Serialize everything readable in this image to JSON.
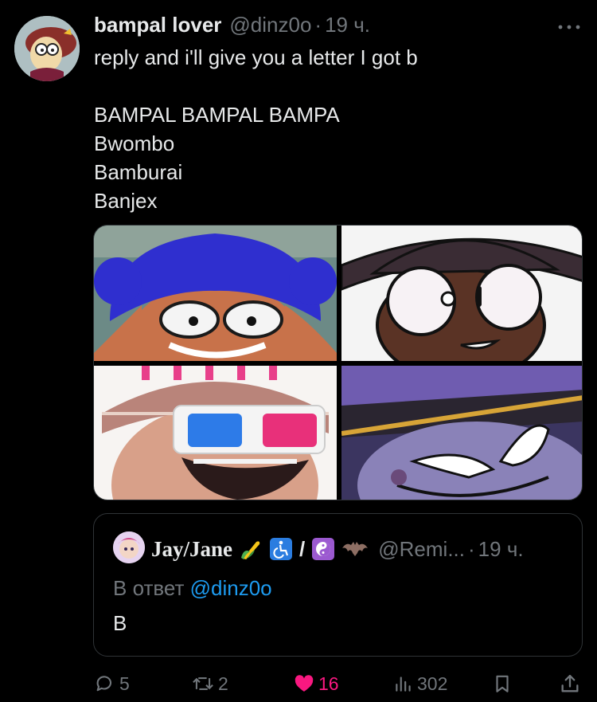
{
  "post": {
    "author_name": "bampal lover",
    "author_handle": "@dinz0o",
    "separator": "·",
    "time": "19 ч.",
    "lines": [
      "reply and i'll give you a letter I got b",
      "BAMPAL BAMPAL BAMPA",
      "Bwombo",
      "Bamburai",
      "Banjex"
    ]
  },
  "media": {
    "images": [
      "blue-beanie-character",
      "black-hat-character",
      "3d-glasses-character",
      "purple-hat-character"
    ]
  },
  "quote": {
    "author_name": "Jay/Jane",
    "slash": "/",
    "handle": "@Remi...",
    "separator": "·",
    "time": "19 ч.",
    "reply_prefix": "В ответ",
    "reply_mention": "@dinz0o",
    "text": "B"
  },
  "actions": {
    "replies": "5",
    "reposts": "2",
    "likes": "16",
    "views": "302"
  },
  "colors": {
    "background": "#000000",
    "text": "#e7e9ea",
    "muted": "#71767b",
    "link": "#1d9bf0",
    "like": "#f91880",
    "border": "#2f3336"
  }
}
